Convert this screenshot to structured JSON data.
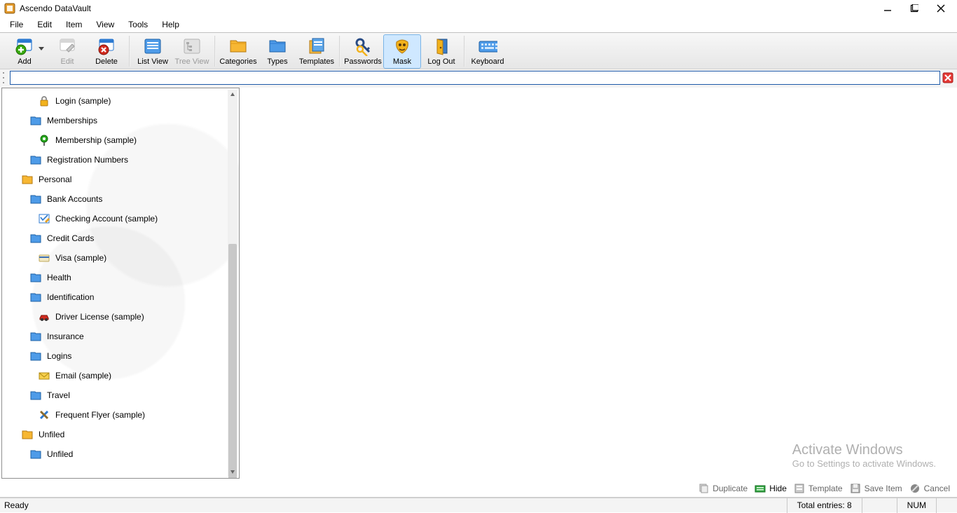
{
  "title": "Ascendo DataVault",
  "menu": [
    "File",
    "Edit",
    "Item",
    "View",
    "Tools",
    "Help"
  ],
  "toolbar": [
    {
      "id": "add",
      "label": "Add",
      "icon": "add",
      "hasDropdown": true
    },
    {
      "id": "edit",
      "label": "Edit",
      "icon": "edit",
      "disabled": true
    },
    {
      "id": "delete",
      "label": "Delete",
      "icon": "delete"
    },
    {
      "sep": true
    },
    {
      "id": "listview",
      "label": "List View",
      "icon": "list"
    },
    {
      "id": "treeview",
      "label": "Tree View",
      "icon": "tree",
      "disabled": true
    },
    {
      "sep": true
    },
    {
      "id": "categories",
      "label": "Categories",
      "icon": "folder-y"
    },
    {
      "id": "types",
      "label": "Types",
      "icon": "folder-b"
    },
    {
      "id": "templates",
      "label": "Templates",
      "icon": "templates"
    },
    {
      "sep": true
    },
    {
      "id": "passwords",
      "label": "Passwords",
      "icon": "keys"
    },
    {
      "id": "mask",
      "label": "Mask",
      "icon": "mask",
      "active": true
    },
    {
      "id": "logout",
      "label": "Log Out",
      "icon": "door"
    },
    {
      "sep": true
    },
    {
      "id": "keyboard",
      "label": "Keyboard",
      "icon": "keyboard"
    }
  ],
  "search": {
    "value": ""
  },
  "tree": [
    {
      "level": 3,
      "icon": "lock",
      "label": "Login (sample)"
    },
    {
      "level": 2,
      "icon": "folder-b",
      "label": "Memberships"
    },
    {
      "level": 3,
      "icon": "pin",
      "label": "Membership (sample)"
    },
    {
      "level": 2,
      "icon": "folder-b",
      "label": "Registration Numbers"
    },
    {
      "level": 1,
      "icon": "folder-y",
      "label": "Personal"
    },
    {
      "level": 2,
      "icon": "folder-b",
      "label": "Bank Accounts"
    },
    {
      "level": 3,
      "icon": "check",
      "label": "Checking Account (sample)"
    },
    {
      "level": 2,
      "icon": "folder-b",
      "label": "Credit Cards"
    },
    {
      "level": 3,
      "icon": "card",
      "label": "Visa (sample)"
    },
    {
      "level": 2,
      "icon": "folder-b",
      "label": "Health"
    },
    {
      "level": 2,
      "icon": "folder-b",
      "label": "Identification"
    },
    {
      "level": 3,
      "icon": "car",
      "label": "Driver License (sample)"
    },
    {
      "level": 2,
      "icon": "folder-b",
      "label": "Insurance"
    },
    {
      "level": 2,
      "icon": "folder-b",
      "label": "Logins"
    },
    {
      "level": 3,
      "icon": "mail",
      "label": "Email (sample)"
    },
    {
      "level": 2,
      "icon": "folder-b",
      "label": "Travel"
    },
    {
      "level": 3,
      "icon": "wrench",
      "label": "Frequent Flyer (sample)"
    },
    {
      "level": 1,
      "icon": "folder-y",
      "label": "Unfiled"
    },
    {
      "level": 2,
      "icon": "folder-b",
      "label": "Unfiled"
    }
  ],
  "detail_actions": [
    {
      "id": "duplicate",
      "label": "Duplicate",
      "icon": "dup",
      "enabled": false
    },
    {
      "id": "hide",
      "label": "Hide",
      "icon": "hide",
      "enabled": true
    },
    {
      "id": "template",
      "label": "Template",
      "icon": "tmpl",
      "enabled": false
    },
    {
      "id": "saveitem",
      "label": "Save Item",
      "icon": "save",
      "enabled": false
    },
    {
      "id": "cancel",
      "label": "Cancel",
      "icon": "cancel",
      "enabled": false
    }
  ],
  "watermark": {
    "line1": "Activate Windows",
    "line2": "Go to Settings to activate Windows."
  },
  "status": {
    "left": "Ready",
    "entries": "Total entries: 8",
    "num": "NUM"
  }
}
